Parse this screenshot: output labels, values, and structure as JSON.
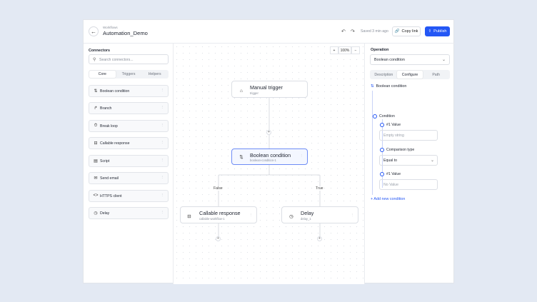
{
  "header": {
    "breadcrumb": "Workflows",
    "title": "Automation_Demo",
    "saved_status": "Saved 3 min ago",
    "copy_link_label": "Copy link",
    "publish_label": "Publish"
  },
  "left_panel": {
    "title": "Connectors",
    "search_placeholder": "Search connectors...",
    "tabs": [
      "Core",
      "Triggers",
      "Helpers"
    ],
    "active_tab": "Core",
    "connectors": [
      {
        "label": "Boolean condition",
        "icon": "git-compare-icon"
      },
      {
        "label": "Branch",
        "icon": "branch-icon"
      },
      {
        "label": "Break loop",
        "icon": "timer-icon"
      },
      {
        "label": "Callable response",
        "icon": "download-box-icon"
      },
      {
        "label": "Script",
        "icon": "document-icon"
      },
      {
        "label": "Send email",
        "icon": "mail-icon"
      },
      {
        "label": "HTTPS client",
        "icon": "code-icon"
      },
      {
        "label": "Delay",
        "icon": "clock-icon"
      }
    ]
  },
  "canvas": {
    "zoom_level": "100%",
    "nodes": {
      "trigger": {
        "title": "Manual trigger",
        "subtitle": "trigger"
      },
      "condition": {
        "title": "Boolean condition",
        "subtitle": "boolean-condition-1"
      },
      "callable": {
        "title": "Callable response",
        "subtitle": "callable-workflow-1"
      },
      "delay": {
        "title": "Delay",
        "subtitle": "delay_1"
      }
    },
    "branch_false": "False",
    "branch_true": "True"
  },
  "right_panel": {
    "title": "Operation",
    "operation_value": "Boolean condition",
    "tabs": [
      "Description",
      "Configure",
      "Path"
    ],
    "active_tab": "Configure",
    "tree_head": "Boolean condition",
    "condition_label": "Condition",
    "value1_label": "#1 Value",
    "value1_placeholder": "Empty string",
    "comparison_label": "Comparison type",
    "comparison_value": "Equal to",
    "value2_label": "#1 Value",
    "value2_placeholder": "No Value",
    "add_condition_label": "Add new condition"
  },
  "colors": {
    "accent": "#2457f5",
    "background": "#e3e9f3",
    "selected_node_border": "#6e8cf5"
  }
}
